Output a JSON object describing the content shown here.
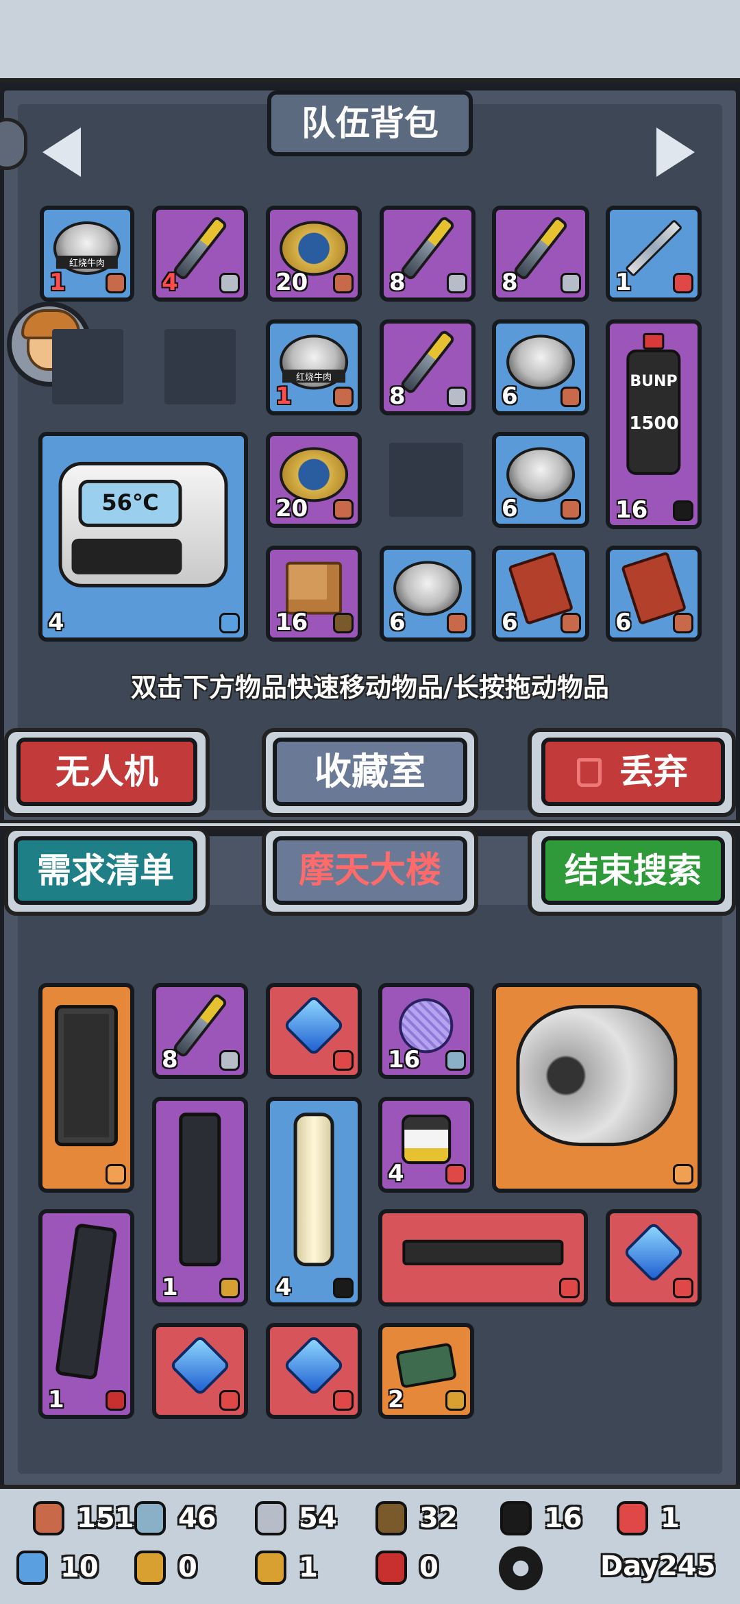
{
  "team_bag": {
    "title": "队伍背包",
    "hint": "双击下方物品快速移动物品/长按拖动物品",
    "items": [
      {
        "count": "1",
        "count_red": true,
        "icon": "canned-beef-icon",
        "badge": "meat-icon",
        "color": "#5a9ad8",
        "label": "红烧牛肉"
      },
      {
        "count": "4",
        "count_red": true,
        "icon": "knife-icon",
        "badge": "iron-icon",
        "color": "#9c55b8"
      },
      {
        "count": "20",
        "count_red": false,
        "icon": "canned-food-gold-icon",
        "badge": "meat-icon",
        "color": "#9c55b8"
      },
      {
        "count": "8",
        "count_red": false,
        "icon": "knife-icon",
        "badge": "iron-icon",
        "color": "#9c55b8"
      },
      {
        "count": "8",
        "count_red": false,
        "icon": "knife-icon",
        "badge": "iron-icon",
        "color": "#9c55b8"
      },
      {
        "count": "1",
        "count_red": false,
        "icon": "syringe-icon",
        "badge": "pill-icon",
        "color": "#5a9ad8"
      },
      {
        "count": "1",
        "count_red": true,
        "icon": "canned-beef-icon",
        "badge": "meat-icon",
        "color": "#5a9ad8",
        "label": "红烧牛肉"
      },
      {
        "count": "8",
        "count_red": false,
        "icon": "knife-icon",
        "badge": "iron-icon",
        "color": "#9c55b8"
      },
      {
        "count": "6",
        "count_red": false,
        "icon": "canned-beef-icon",
        "badge": "meat-icon",
        "color": "#5a9ad8"
      },
      {
        "count": "16",
        "count_red": false,
        "icon": "fuel-bottle-icon",
        "badge": "oil-icon",
        "color": "#9c55b8",
        "label_top": "BUNP",
        "label_num": "1500"
      },
      {
        "count": "4",
        "count_red": false,
        "icon": "thermostat-icon",
        "badge": "battery-icon",
        "color": "#5a9ad8",
        "display": "56℃"
      },
      {
        "count": "20",
        "count_red": false,
        "icon": "canned-food-gold-icon",
        "badge": "meat-icon",
        "color": "#9c55b8"
      },
      {
        "count": "6",
        "count_red": false,
        "icon": "canned-beef-icon",
        "badge": "meat-icon",
        "color": "#5a9ad8"
      },
      {
        "count": "16",
        "count_red": false,
        "icon": "wood-cube-icon",
        "badge": "wood-icon",
        "color": "#9c55b8"
      },
      {
        "count": "6",
        "count_red": false,
        "icon": "canned-beef-icon",
        "badge": "meat-icon",
        "color": "#5a9ad8"
      },
      {
        "count": "6",
        "count_red": false,
        "icon": "ration-pack-icon",
        "badge": "meat-icon",
        "color": "#5a9ad8"
      },
      {
        "count": "6",
        "count_red": false,
        "icon": "ration-pack-icon",
        "badge": "meat-icon",
        "color": "#5a9ad8"
      }
    ]
  },
  "buttons": {
    "drone": "无人机",
    "collection": "收藏室",
    "discard": "丢弃",
    "need_list": "需求清单",
    "location": "摩天大楼",
    "end_search": "结束搜索"
  },
  "loot": {
    "items": [
      {
        "count": "",
        "icon": "ammo-crate-icon",
        "badge": "rank-s-icon",
        "color": "#e5883a"
      },
      {
        "count": "8",
        "icon": "knife-icon",
        "badge": "iron-icon",
        "color": "#9c55b8"
      },
      {
        "count": "",
        "icon": "blue-gem-icon",
        "badge": "rank-ur-icon",
        "color": "#d6545a"
      },
      {
        "count": "16",
        "icon": "yarn-ball-icon",
        "badge": "cloth-icon",
        "color": "#9c55b8"
      },
      {
        "count": "",
        "icon": "engine-part-icon",
        "badge": "rank-s-icon",
        "color": "#e5883a"
      },
      {
        "count": "1",
        "icon": "rifle-magazine-icon",
        "badge": "bullets-icon",
        "color": "#9c55b8"
      },
      {
        "count": "4",
        "icon": "lantern-icon",
        "badge": "oil-icon",
        "color": "#5a9ad8"
      },
      {
        "count": "4",
        "icon": "medicine-jar-icon",
        "badge": "pill-icon",
        "color": "#9c55b8"
      },
      {
        "count": "",
        "icon": "assault-rifle-icon",
        "badge": "rank-ur-icon",
        "color": "#d6545a"
      },
      {
        "count": "",
        "icon": "blue-gem-icon",
        "badge": "rank-ur-icon",
        "color": "#d6545a"
      },
      {
        "count": "1",
        "icon": "curved-magazine-icon",
        "badge": "shells-icon",
        "color": "#9c55b8"
      },
      {
        "count": "",
        "icon": "blue-gem-icon",
        "badge": "rank-ur-icon",
        "color": "#d6545a"
      },
      {
        "count": "",
        "icon": "blue-gem-icon",
        "badge": "rank-ur-icon",
        "color": "#d6545a"
      },
      {
        "count": "2",
        "icon": "ammo-box-icon",
        "badge": "bullets-icon",
        "color": "#e5883a"
      }
    ]
  },
  "resources": {
    "meat": "151",
    "cloth": "46",
    "iron": "54",
    "wood": "32",
    "oil": "16",
    "pill": "1",
    "battery": "10",
    "ammo_a": "0",
    "ammo_b": "1",
    "shells": "0",
    "day": "Day245"
  }
}
